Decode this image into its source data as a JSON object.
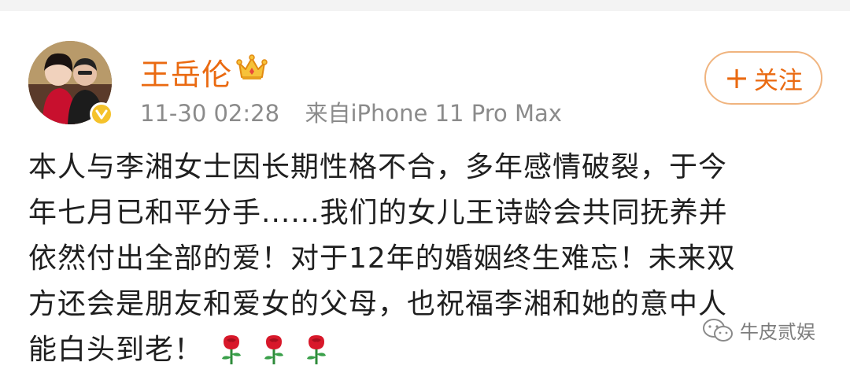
{
  "user": {
    "name": "王岳伦",
    "timestamp": "11-30 02:28",
    "source": "来自iPhone 11 Pro Max"
  },
  "follow_button": {
    "plus": "+",
    "label": "关注"
  },
  "post": {
    "lines": [
      "本人与李湘女士因长期性格不合，多年感情破裂，于今",
      "年七月已和平分手......我们的女儿王诗龄会共同抚养并",
      "依然付出全部的爱！对于12年的婚姻终生难忘！未来双",
      "方还会是朋友和爱女的父母，也祝福李湘和她的意中人",
      "能白头到老！"
    ],
    "emoji": [
      "rose-icon",
      "rose-icon",
      "rose-icon"
    ]
  },
  "watermark": {
    "text": "牛皮贰娱"
  },
  "colors": {
    "accent": "#ea6a11",
    "meta": "#8b8b8b",
    "verified": "#f5c22b"
  }
}
